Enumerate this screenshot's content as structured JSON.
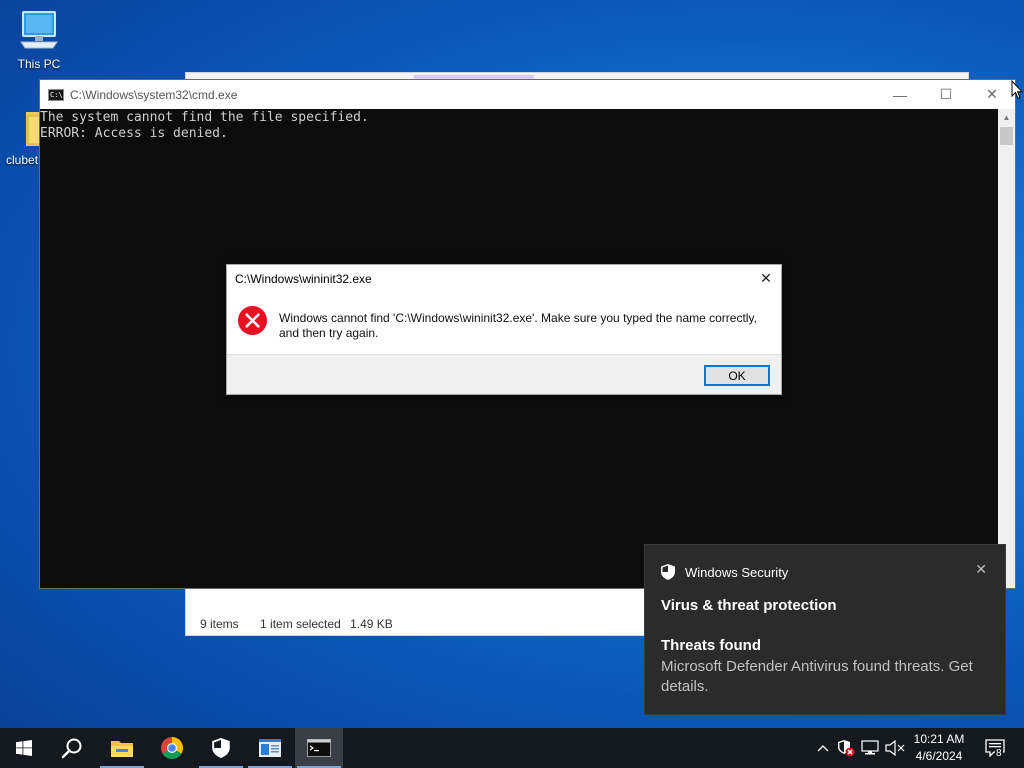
{
  "desktop": {
    "icons": [
      {
        "label": "This PC"
      },
      {
        "label": "clubet"
      }
    ]
  },
  "explorer": {
    "status_items": "9 items",
    "status_selected": "1 item selected",
    "status_size": "1.49 KB"
  },
  "cmd": {
    "title": "C:\\Windows\\system32\\cmd.exe",
    "lines": [
      "The system cannot find the file specified.",
      "ERROR: Access is denied."
    ],
    "controls": {
      "minimize": "—",
      "maximize": "☐",
      "close": "✕"
    }
  },
  "dialog": {
    "title": "C:\\Windows\\wininit32.exe",
    "message": "Windows cannot find 'C:\\Windows\\wininit32.exe'. Make sure you typed the name correctly, and then try again.",
    "ok_label": "OK",
    "close": "✕"
  },
  "toast": {
    "app_name": "Windows Security",
    "heading": "Virus & threat protection",
    "title": "Threats found",
    "body": "Microsoft Defender Antivirus found threats. Get details.",
    "close": "✕"
  },
  "taskbar": {
    "items": [
      "start-icon",
      "search-icon",
      "file-explorer-icon",
      "chrome-icon",
      "windows-security-icon",
      "app-icon",
      "cmd-icon"
    ],
    "tray_chevron": "^",
    "clock_time": "10:21 AM",
    "clock_date": "4/6/2024",
    "notification_count": "8"
  },
  "colors": {
    "accent": "#0078d7",
    "error_red": "#e81123",
    "taskbar": "#141920",
    "toast_bg": "#2b2b2b"
  }
}
